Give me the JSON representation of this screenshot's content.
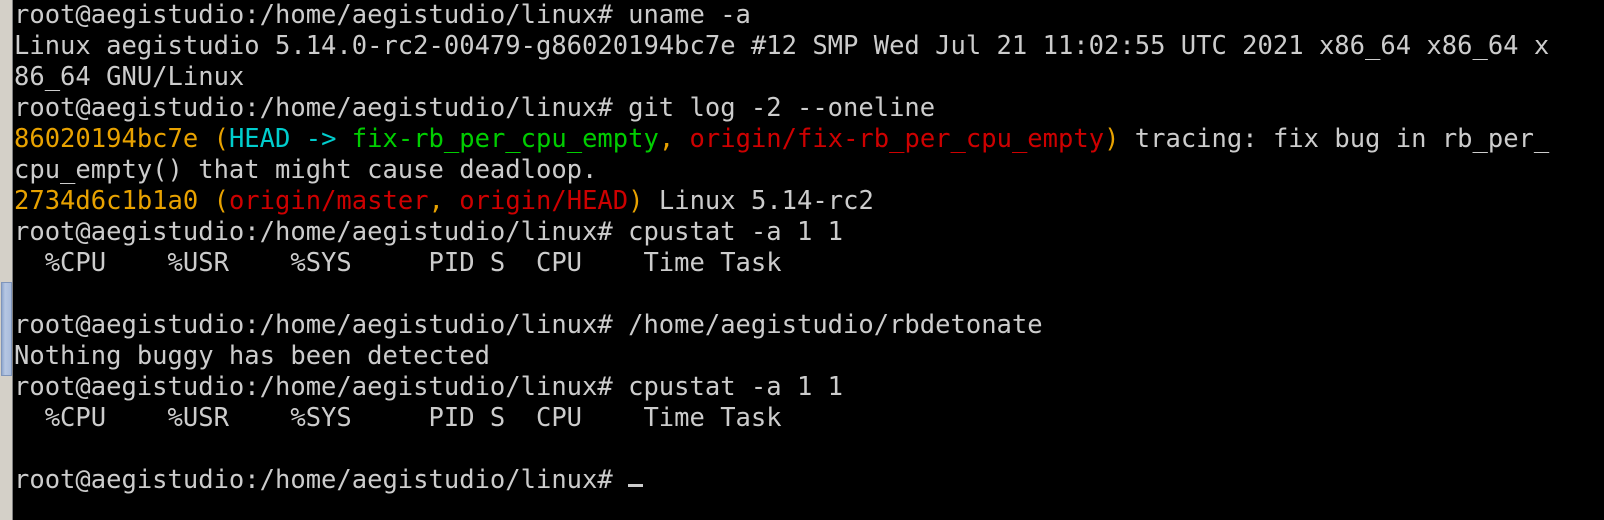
{
  "terminal": {
    "background_color": "#000000",
    "foreground_color": "#cccccc",
    "prompt": "root@aegistudio:/home/aegistudio/linux# ",
    "scrollbar": {
      "track_color": "#d4d0c8",
      "thumb_color": "#a8bbdc",
      "name": "vertical-scrollbar"
    },
    "palette": {
      "yellow": "#e8a200",
      "cyan": "#00cdcd",
      "green": "#00cd00",
      "red": "#cd0000",
      "white": "#cccccc"
    },
    "lines": [
      {
        "id": "line-1",
        "kind": "command",
        "segments": [
          {
            "text": "root@aegistudio:/home/aegistudio/linux# ",
            "color": "default"
          },
          {
            "text": "uname -a",
            "color": "default"
          }
        ]
      },
      {
        "id": "line-2",
        "kind": "output",
        "segments": [
          {
            "text": "Linux aegistudio 5.14.0-rc2-00479-g86020194bc7e #12 SMP Wed Jul 21 11:02:55 UTC 2021 x86_64 x86_64 x",
            "color": "default"
          }
        ]
      },
      {
        "id": "line-3",
        "kind": "output-wrap",
        "segments": [
          {
            "text": "86_64 GNU/Linux",
            "color": "default"
          }
        ]
      },
      {
        "id": "line-4",
        "kind": "command",
        "segments": [
          {
            "text": "root@aegistudio:/home/aegistudio/linux# ",
            "color": "default"
          },
          {
            "text": "git log -2 --oneline",
            "color": "default"
          }
        ]
      },
      {
        "id": "line-5",
        "kind": "git-log-entry",
        "segments": [
          {
            "text": "86020194bc7e",
            "color": "yellow"
          },
          {
            "text": " ",
            "color": "default"
          },
          {
            "text": "(",
            "color": "yellow"
          },
          {
            "text": "HEAD -> ",
            "color": "cyan"
          },
          {
            "text": "fix-rb_per_cpu_empty",
            "color": "green"
          },
          {
            "text": ", ",
            "color": "yellow"
          },
          {
            "text": "origin/fix-rb_per_cpu_empty",
            "color": "red"
          },
          {
            "text": ")",
            "color": "yellow"
          },
          {
            "text": " tracing: fix bug in rb_per_",
            "color": "default"
          }
        ]
      },
      {
        "id": "line-6",
        "kind": "output-wrap",
        "segments": [
          {
            "text": "cpu_empty() that might cause deadloop.",
            "color": "default"
          }
        ]
      },
      {
        "id": "line-7",
        "kind": "git-log-entry",
        "segments": [
          {
            "text": "2734d6c1b1a0",
            "color": "yellow"
          },
          {
            "text": " ",
            "color": "default"
          },
          {
            "text": "(",
            "color": "yellow"
          },
          {
            "text": "origin/master",
            "color": "red"
          },
          {
            "text": ", ",
            "color": "yellow"
          },
          {
            "text": "origin/HEAD",
            "color": "red"
          },
          {
            "text": ")",
            "color": "yellow"
          },
          {
            "text": " Linux 5.14-rc2",
            "color": "default"
          }
        ]
      },
      {
        "id": "line-8",
        "kind": "command",
        "segments": [
          {
            "text": "root@aegistudio:/home/aegistudio/linux# ",
            "color": "default"
          },
          {
            "text": "cpustat -a 1 1",
            "color": "default"
          }
        ]
      },
      {
        "id": "line-9",
        "kind": "table-header",
        "segments": [
          {
            "text": "  %CPU    %USR    %SYS     PID S  CPU    Time Task",
            "color": "default"
          }
        ]
      },
      {
        "id": "line-10",
        "kind": "blank",
        "segments": [
          {
            "text": " ",
            "color": "default"
          }
        ]
      },
      {
        "id": "line-11",
        "kind": "command",
        "segments": [
          {
            "text": "root@aegistudio:/home/aegistudio/linux# ",
            "color": "default"
          },
          {
            "text": "/home/aegistudio/rbdetonate",
            "color": "default"
          }
        ]
      },
      {
        "id": "line-12",
        "kind": "output",
        "segments": [
          {
            "text": "Nothing buggy has been detected",
            "color": "default"
          }
        ]
      },
      {
        "id": "line-13",
        "kind": "command",
        "segments": [
          {
            "text": "root@aegistudio:/home/aegistudio/linux# ",
            "color": "default"
          },
          {
            "text": "cpustat -a 1 1",
            "color": "default"
          }
        ]
      },
      {
        "id": "line-14",
        "kind": "table-header",
        "segments": [
          {
            "text": "  %CPU    %USR    %SYS     PID S  CPU    Time Task",
            "color": "default"
          }
        ]
      },
      {
        "id": "line-15",
        "kind": "blank",
        "segments": [
          {
            "text": " ",
            "color": "default"
          }
        ]
      },
      {
        "id": "line-16",
        "kind": "prompt-cursor",
        "segments": [
          {
            "text": "root@aegistudio:/home/aegistudio/linux# ",
            "color": "default"
          }
        ],
        "cursor": true
      }
    ]
  }
}
